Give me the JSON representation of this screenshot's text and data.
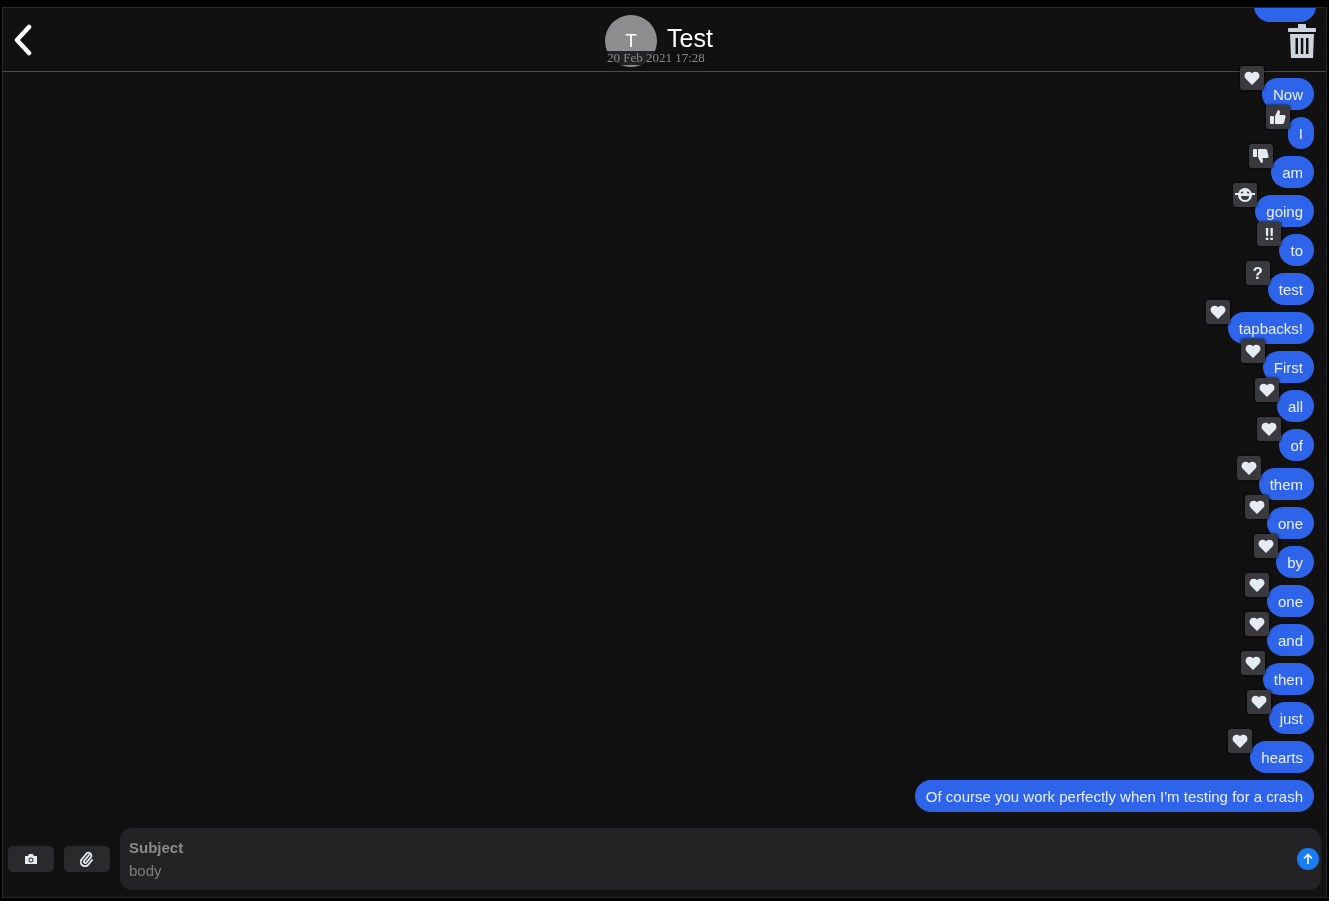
{
  "header": {
    "avatar_initial": "T",
    "name": "Test",
    "date": "20 Feb 2021 17:28"
  },
  "messages": [
    {
      "text": "Now",
      "reaction": {
        "kind": "heart"
      }
    },
    {
      "text": "I",
      "reaction": {
        "kind": "like"
      }
    },
    {
      "text": "am",
      "reaction": {
        "kind": "dislike"
      }
    },
    {
      "text": "going",
      "reaction": {
        "kind": "laugh"
      }
    },
    {
      "text": "to",
      "reaction": {
        "kind": "emphasize",
        "glyph": "‼"
      }
    },
    {
      "text": "test",
      "reaction": {
        "kind": "question",
        "glyph": "?"
      }
    },
    {
      "text": "tapbacks!",
      "reaction": {
        "kind": "heart"
      }
    },
    {
      "text": "First",
      "reaction": {
        "kind": "heart"
      }
    },
    {
      "text": "all",
      "reaction": {
        "kind": "heart"
      }
    },
    {
      "text": "of",
      "reaction": {
        "kind": "heart"
      }
    },
    {
      "text": "them",
      "reaction": {
        "kind": "heart"
      }
    },
    {
      "text": "one",
      "reaction": {
        "kind": "heart"
      }
    },
    {
      "text": "by",
      "reaction": {
        "kind": "heart"
      }
    },
    {
      "text": "one",
      "reaction": {
        "kind": "heart"
      }
    },
    {
      "text": "and",
      "reaction": {
        "kind": "heart"
      }
    },
    {
      "text": "then",
      "reaction": {
        "kind": "heart"
      }
    },
    {
      "text": "just",
      "reaction": {
        "kind": "heart"
      }
    },
    {
      "text": "hearts",
      "reaction": {
        "kind": "heart"
      }
    },
    {
      "text": "Of course you work perfectly when I'm testing for a crash"
    }
  ],
  "composer": {
    "subject": {
      "placeholder": "Subject"
    },
    "body": {
      "placeholder": "body"
    }
  }
}
